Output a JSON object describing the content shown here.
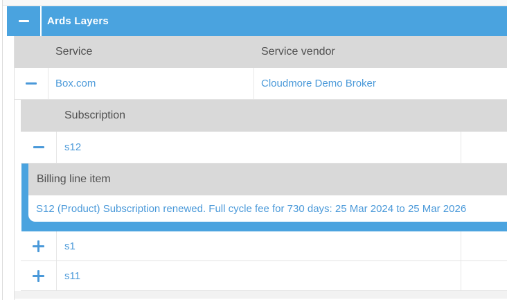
{
  "panel": {
    "title": "Ards Layers"
  },
  "colors": {
    "accent_blue": "#4aa3df",
    "link_blue": "#4a99d9",
    "header_gray": "#d9d9d9"
  },
  "service_table": {
    "headers": {
      "service": "Service",
      "vendor": "Service vendor"
    },
    "rows": [
      {
        "service": "Box.com",
        "vendor": "Cloudmore Demo Broker",
        "state": "expanded"
      }
    ]
  },
  "subscription_table": {
    "header": "Subscription",
    "rows": [
      {
        "name": "s12",
        "state": "expanded"
      },
      {
        "name": "s1",
        "state": "collapsed"
      },
      {
        "name": "s11",
        "state": "collapsed"
      }
    ]
  },
  "billing_table": {
    "header": "Billing line item",
    "rows": [
      {
        "line_item": "S12 (Product) Subscription renewed. Full cycle fee for 730 days: 25 Mar 2024 to 25 Mar 2026"
      }
    ]
  }
}
